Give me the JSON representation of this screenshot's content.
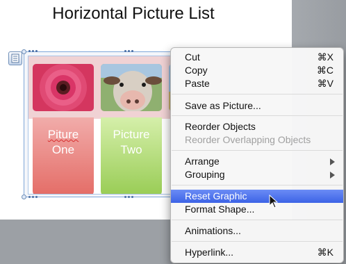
{
  "slide": {
    "title": "Horizontal Picture List"
  },
  "smartart": {
    "cards": [
      {
        "line1": "Piture",
        "line2": "One",
        "color": "#e4716a"
      },
      {
        "line1": "Picture",
        "line2": "Two",
        "color": "#9acd57"
      }
    ],
    "thumbnails": [
      "pink-gerbera-flower",
      "cow-face",
      "partial-image"
    ]
  },
  "context_menu": {
    "cut": {
      "label": "Cut",
      "shortcut": "⌘X"
    },
    "copy": {
      "label": "Copy",
      "shortcut": "⌘C"
    },
    "paste": {
      "label": "Paste",
      "shortcut": "⌘V"
    },
    "save_as_picture": "Save as Picture...",
    "reorder_objects": "Reorder Objects",
    "reorder_overlapping": "Reorder Overlapping Objects",
    "arrange": "Arrange",
    "grouping": "Grouping",
    "reset_graphic": "Reset Graphic",
    "format_shape": "Format Shape...",
    "animations": "Animations...",
    "hyperlink": {
      "label": "Hyperlink...",
      "shortcut": "⌘K"
    }
  },
  "colors": {
    "highlight": "#3f66e8",
    "selection_border": "#7fa6d8"
  }
}
